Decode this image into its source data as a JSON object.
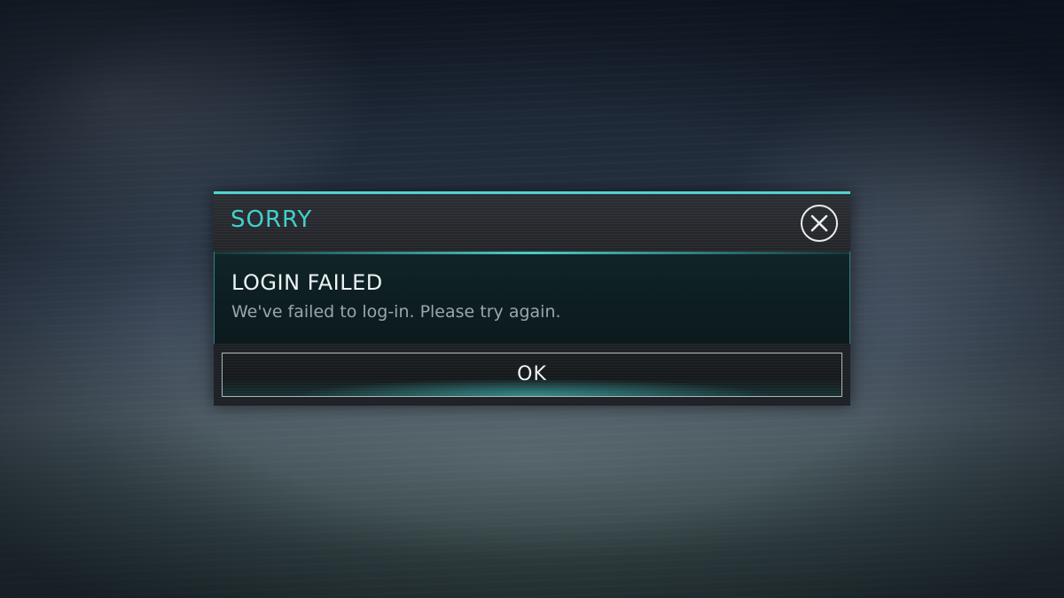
{
  "dialog": {
    "header_title": "SORRY",
    "close_icon": "close-x-icon",
    "heading": "LOGIN FAILED",
    "message": "We've failed to log-in. Please try again.",
    "ok_label": "OK"
  },
  "colors": {
    "accent": "#43d0cd",
    "text_primary": "#eef2f2",
    "text_secondary": "#9aa6a8",
    "panel_dark": "#1d2024",
    "body_teal_dark": "#0d1d21"
  }
}
